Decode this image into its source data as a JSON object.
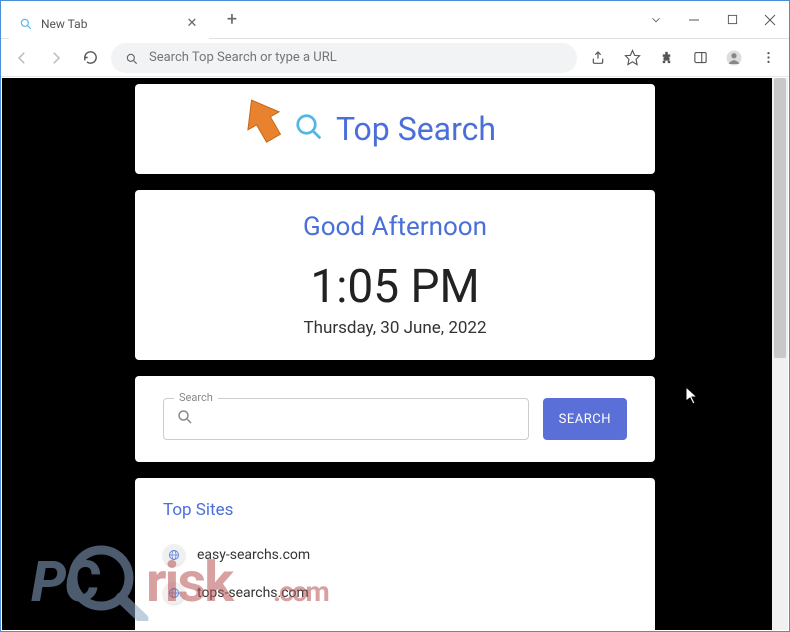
{
  "window": {
    "tab_title": "New Tab",
    "omnibox_placeholder": "Search Top Search or type a URL"
  },
  "logo": {
    "text": "Top Search"
  },
  "clock": {
    "greeting": "Good Afternoon",
    "time": "1:05 PM",
    "date": "Thursday, 30 June, 2022"
  },
  "search": {
    "field_label": "Search",
    "button_label": "SEARCH"
  },
  "topsites": {
    "title": "Top Sites",
    "items": [
      {
        "domain": "easy-searchs.com"
      },
      {
        "domain": "tops-searchs.com"
      }
    ]
  },
  "watermark": {
    "pc": "PC",
    "risk": "risk",
    "com": ".com"
  }
}
